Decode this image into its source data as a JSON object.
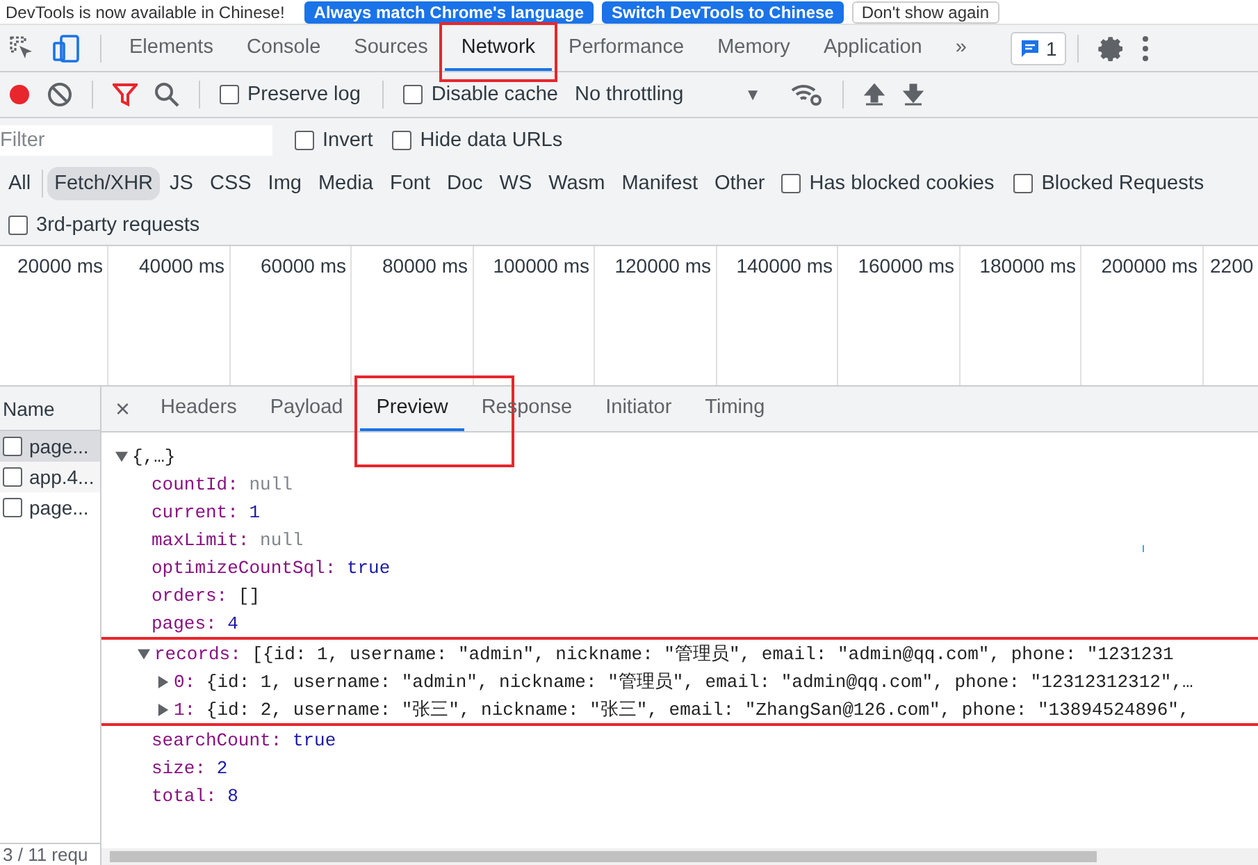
{
  "banner": {
    "message": "DevTools is now available in Chinese!",
    "buttons": [
      {
        "label": "Always match Chrome's language",
        "primary": true
      },
      {
        "label": "Switch DevTools to Chinese",
        "primary": true
      },
      {
        "label": "Don't show again",
        "primary": false
      }
    ]
  },
  "panel_tabs": [
    {
      "label": "Elements",
      "selected": false,
      "boxed": false
    },
    {
      "label": "Console",
      "selected": false,
      "boxed": false
    },
    {
      "label": "Sources",
      "selected": false,
      "boxed": false
    },
    {
      "label": "Network",
      "selected": true,
      "boxed": true
    },
    {
      "label": "Performance",
      "selected": false,
      "boxed": false
    },
    {
      "label": "Memory",
      "selected": false,
      "boxed": false
    },
    {
      "label": "Application",
      "selected": false,
      "boxed": false
    }
  ],
  "more_tabs": "»",
  "issues_count": "1",
  "toolbar": {
    "recording": true,
    "filter_active": true,
    "preserve_log": {
      "label": "Preserve log",
      "checked": false
    },
    "disable_cache": {
      "label": "Disable cache",
      "checked": false
    },
    "throttling": "No throttling",
    "throttling_caret": "▼"
  },
  "filter": {
    "placeholder": "Filter",
    "invert": {
      "label": "Invert",
      "checked": false
    },
    "hide_data_urls": {
      "label": "Hide data URLs",
      "checked": false
    }
  },
  "type_filters": [
    {
      "label": "All",
      "selected": false
    },
    {
      "label": "Fetch/XHR",
      "selected": true
    },
    {
      "label": "JS",
      "selected": false
    },
    {
      "label": "CSS",
      "selected": false
    },
    {
      "label": "Img",
      "selected": false
    },
    {
      "label": "Media",
      "selected": false
    },
    {
      "label": "Font",
      "selected": false
    },
    {
      "label": "Doc",
      "selected": false
    },
    {
      "label": "WS",
      "selected": false
    },
    {
      "label": "Wasm",
      "selected": false
    },
    {
      "label": "Manifest",
      "selected": false
    },
    {
      "label": "Other",
      "selected": false
    }
  ],
  "type_options": [
    {
      "label": "Has blocked cookies",
      "checked": false
    },
    {
      "label": "Blocked Requests",
      "checked": false
    }
  ],
  "third_party": {
    "label": "3rd-party requests",
    "checked": false
  },
  "timeline": {
    "ticks": [
      "20000 ms",
      "40000 ms",
      "60000 ms",
      "80000 ms",
      "100000 ms",
      "120000 ms",
      "140000 ms",
      "160000 ms",
      "180000 ms",
      "200000 ms",
      "2200"
    ]
  },
  "requests": {
    "header": "Name",
    "items": [
      {
        "name": "page...",
        "selected": true
      },
      {
        "name": "app.4...",
        "selected": false
      },
      {
        "name": "page...",
        "selected": false
      }
    ],
    "status": "3 / 11 requ"
  },
  "close_icon": "×",
  "detail_tabs": [
    {
      "label": "Headers",
      "selected": false,
      "boxed": false
    },
    {
      "label": "Payload",
      "selected": false,
      "boxed": false
    },
    {
      "label": "Preview",
      "selected": true,
      "boxed": true
    },
    {
      "label": "Response",
      "selected": false,
      "boxed": false
    },
    {
      "label": "Initiator",
      "selected": false,
      "boxed": false
    },
    {
      "label": "Timing",
      "selected": false,
      "boxed": false
    }
  ],
  "preview": {
    "label": "{,…}",
    "expanded": true,
    "children": [
      {
        "key": "countId:",
        "value": "null",
        "kind": "null"
      },
      {
        "key": "current:",
        "value": "1",
        "kind": "number"
      },
      {
        "key": "maxLimit:",
        "value": "null",
        "kind": "null"
      },
      {
        "key": "optimizeCountSql:",
        "value": "true",
        "kind": "boolean"
      },
      {
        "key": "orders:",
        "value": "[]",
        "kind": "preview"
      },
      {
        "key": "pages:",
        "value": "4",
        "kind": "number"
      },
      {
        "key": "records:",
        "value": "[{id: 1, username: \"admin\", nickname: \"管理员\", email: \"admin@qq.com\", phone: \"1231231",
        "kind": "preview",
        "expanded": true,
        "boxed": true,
        "children": [
          {
            "key": "0:",
            "value": "{id: 1, username: \"admin\", nickname: \"管理员\", email: \"admin@qq.com\", phone: \"12312312312\",…",
            "kind": "preview",
            "expanded": false
          },
          {
            "key": "1:",
            "value": "{id: 2, username: \"张三\", nickname: \"张三\", email: \"ZhangSan@126.com\", phone: \"13894524896\",",
            "kind": "preview",
            "expanded": false
          }
        ]
      },
      {
        "key": "searchCount:",
        "value": "true",
        "kind": "boolean"
      },
      {
        "key": "size:",
        "value": "2",
        "kind": "number"
      },
      {
        "key": "total:",
        "value": "8",
        "kind": "number"
      }
    ]
  }
}
